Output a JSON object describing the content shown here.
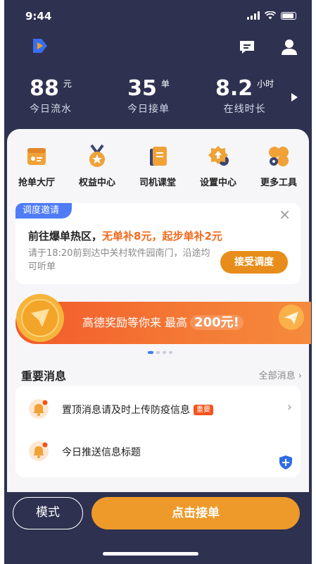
{
  "status_bar": {
    "time": "9:44"
  },
  "header": {
    "logo_icon": "app-logo-icon",
    "message_icon": "message-icon",
    "profile_icon": "profile-icon"
  },
  "stats": [
    {
      "value": "88",
      "unit": "元",
      "label": "今日流水"
    },
    {
      "value": "35",
      "unit": "单",
      "label": "今日接单"
    },
    {
      "value": "8.2",
      "unit": "小时",
      "label": "在线时长"
    }
  ],
  "tools": [
    {
      "label": "抢单大厅",
      "icon": "order-hall-icon"
    },
    {
      "label": "权益中心",
      "icon": "medal-icon"
    },
    {
      "label": "司机课堂",
      "icon": "book-icon"
    },
    {
      "label": "设置中心",
      "icon": "settings-gear-icon"
    },
    {
      "label": "更多工具",
      "icon": "more-tools-icon"
    }
  ],
  "dispatch": {
    "tag": "调度邀请",
    "close": "×",
    "title_prefix": "前往爆单热区，",
    "title_highlight": "无单补8元，起步单补2元",
    "description": "请于18:20前到达中关村软件园南门，沿途均可听单",
    "accept_label": "接受调度"
  },
  "banner": {
    "text": "高德奖励等你来 最高",
    "amount": "200元!"
  },
  "carousel": {
    "total": 4,
    "active": 0
  },
  "messages": {
    "title": "重要消息",
    "all_label": "全部消息 ›",
    "items": [
      {
        "text": "置顶消息请及时上传防疫信息",
        "badge": "重要",
        "arrow": "›"
      },
      {
        "text": "今日推送信息标题",
        "badge": "",
        "arrow": ""
      }
    ]
  },
  "bottom": {
    "mode_label": "模式",
    "grab_label": "点击接单"
  },
  "colors": {
    "nav_bg": "#2e3150",
    "accent_orange": "#e88d1b",
    "highlight": "#f16a1c",
    "tag_blue": "#4f7cf6"
  }
}
